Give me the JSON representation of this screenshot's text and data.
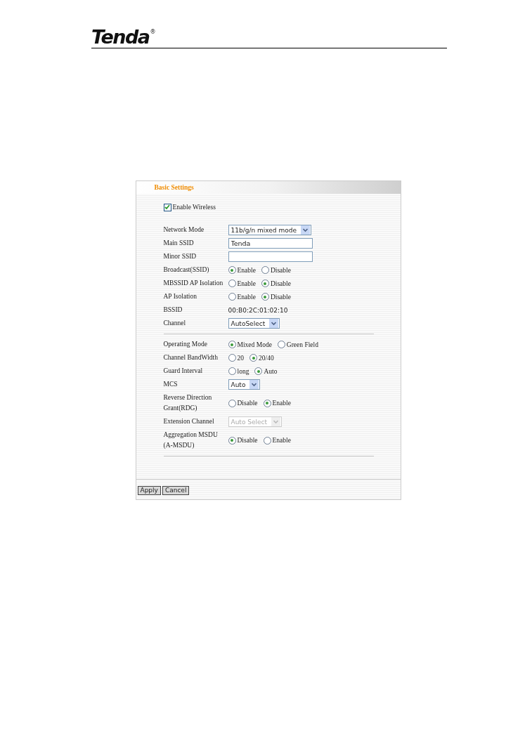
{
  "header": {
    "logo": "Tenda",
    "registered": "®"
  },
  "panel": {
    "title": "Basic Settings",
    "enable_wireless": {
      "label": "Enable Wireless",
      "checked": true
    },
    "rows": [
      {
        "kind": "select",
        "label": "Network Mode",
        "value": "11b/g/n mixed mode",
        "disabled": false
      },
      {
        "kind": "text",
        "label": "Main SSID",
        "value": "Tenda"
      },
      {
        "kind": "text",
        "label": "Minor SSID"
      },
      {
        "kind": "radio",
        "label": "Broadcast(SSID)",
        "options": [
          {
            "label": "Enable",
            "selected": true
          },
          {
            "label": "Disable",
            "selected": false
          }
        ]
      },
      {
        "kind": "radio",
        "label": "MBSSID AP Isolation",
        "options": [
          {
            "label": "Enable",
            "selected": false
          },
          {
            "label": "Disable",
            "selected": true
          }
        ]
      },
      {
        "kind": "radio",
        "label": "AP Isolation",
        "options": [
          {
            "label": "Enable",
            "selected": false
          },
          {
            "label": "Disable",
            "selected": true
          }
        ]
      },
      {
        "kind": "static",
        "label": "BSSID",
        "value": "00:B0:2C:01:02:10"
      },
      {
        "kind": "select",
        "label": "Channel",
        "value": "AutoSelect",
        "disabled": false
      },
      {
        "kind": "divider"
      },
      {
        "kind": "radio",
        "label": "Operating Mode",
        "options": [
          {
            "label": "Mixed Mode",
            "selected": true
          },
          {
            "label": "Green Field",
            "selected": false
          }
        ]
      },
      {
        "kind": "radio",
        "label": "Channel BandWidth",
        "options": [
          {
            "label": "20",
            "selected": false
          },
          {
            "label": "20/40",
            "selected": true
          }
        ]
      },
      {
        "kind": "radio",
        "label": "Guard Interval",
        "options": [
          {
            "label": "long",
            "selected": false
          },
          {
            "label": "Auto",
            "selected": true
          }
        ]
      },
      {
        "kind": "select",
        "label": "MCS",
        "value": "Auto",
        "disabled": false
      },
      {
        "kind": "radio",
        "label": "Reverse Direction Grant(RDG)",
        "options": [
          {
            "label": "Disable",
            "selected": false
          },
          {
            "label": "Enable",
            "selected": true
          }
        ]
      },
      {
        "kind": "select",
        "label": "Extension Channel",
        "value": "Auto Select",
        "disabled": true
      },
      {
        "kind": "radio",
        "label": "Aggregation MSDU (A-MSDU)",
        "options": [
          {
            "label": "Disable",
            "selected": true
          },
          {
            "label": "Enable",
            "selected": false
          }
        ]
      },
      {
        "kind": "divider"
      }
    ],
    "buttons": [
      "Apply",
      "Cancel"
    ]
  }
}
